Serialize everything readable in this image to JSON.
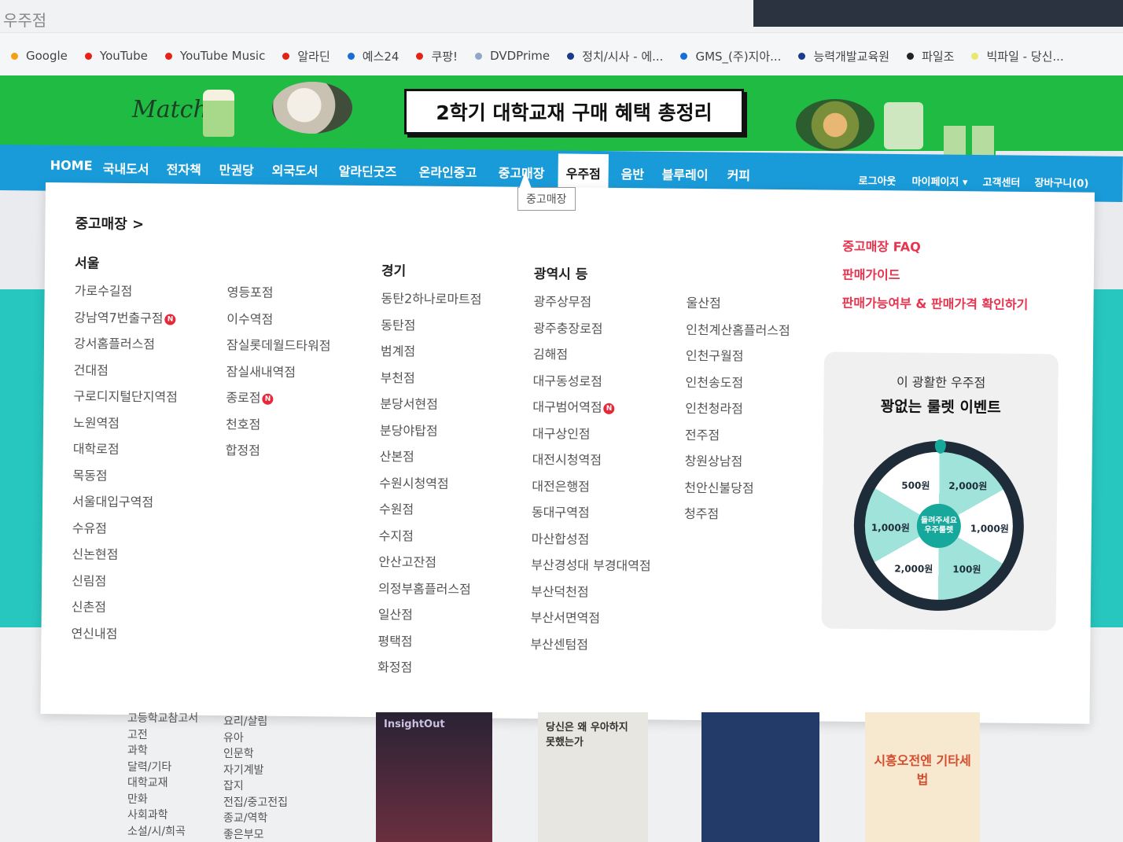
{
  "browser": {
    "tab_title": "우주점",
    "bookmarks": [
      {
        "label": "Google",
        "color": "#f4a017"
      },
      {
        "label": "YouTube",
        "color": "#e62117"
      },
      {
        "label": "YouTube Music",
        "color": "#e62117"
      },
      {
        "label": "알라딘",
        "color": "#e62117"
      },
      {
        "label": "예스24",
        "color": "#1a6cd6"
      },
      {
        "label": "쿠팡!",
        "color": "#e62117"
      },
      {
        "label": "DVDPrime",
        "color": "#8fa8c8"
      },
      {
        "label": "정치/시사 - 에...",
        "color": "#1a3a8a"
      },
      {
        "label": "GMS_(주)지아...",
        "color": "#1a6cd6"
      },
      {
        "label": "능력개발교육원",
        "color": "#1a3a8a"
      },
      {
        "label": "파일조",
        "color": "#222222"
      },
      {
        "label": "빅파일 - 당신...",
        "color": "#e8e86a"
      }
    ]
  },
  "banner": {
    "logo_text": "Matcha",
    "headline": "2학기 대학교재 구매 혜택 총정리"
  },
  "nav": {
    "items": [
      {
        "label": "HOME"
      },
      {
        "label": "국내도서"
      },
      {
        "label": "전자책"
      },
      {
        "label": "만권당"
      },
      {
        "label": "외국도서"
      },
      {
        "label": "알라딘굿즈"
      },
      {
        "label": "온라인중고"
      },
      {
        "label": "중고매장"
      },
      {
        "label": "우주점"
      },
      {
        "label": "음반"
      },
      {
        "label": "블루레이"
      },
      {
        "label": "커피"
      }
    ],
    "active": "우주점",
    "right": [
      {
        "label": "로그아웃"
      },
      {
        "label": "마이페이지 ▾"
      },
      {
        "label": "고객센터"
      },
      {
        "label": "장바구니(0)"
      }
    ],
    "tooltip": "중고매장"
  },
  "dropdown": {
    "title": "중고매장 >",
    "seoul": {
      "heading": "서울",
      "col1": [
        "가로수길점",
        "강남역7번출구점",
        "강서홈플러스점",
        "건대점",
        "구로디지털단지역점",
        "노원역점",
        "대학로점",
        "목동점",
        "서울대입구역점",
        "수유점",
        "신논현점",
        "신림점",
        "신촌점",
        "연신내점"
      ],
      "col2": [
        "영등포점",
        "이수역점",
        "잠실롯데월드타워점",
        "잠실새내역점",
        "종로점",
        "천호점",
        "합정점"
      ]
    },
    "gyeonggi": {
      "heading": "경기",
      "items": [
        "동탄2하나로마트점",
        "동탄점",
        "범계점",
        "부천점",
        "분당서현점",
        "분당야탑점",
        "산본점",
        "수원시청역점",
        "수원점",
        "수지점",
        "안산고잔점",
        "의정부홈플러스점",
        "일산점",
        "평택점",
        "화정점"
      ]
    },
    "metro": {
      "heading": "광역시 등",
      "col1": [
        "광주상무점",
        "광주충장로점",
        "김해점",
        "대구동성로점",
        "대구범어역점",
        "대구상인점",
        "대전시청역점",
        "대전은행점",
        "동대구역점",
        "마산합성점",
        "부산경성대 부경대역점",
        "부산덕천점",
        "부산서면역점",
        "부산센텀점"
      ],
      "col2": [
        "울산점",
        "인천계산홈플러스점",
        "인천구월점",
        "인천송도점",
        "인천청라점",
        "전주점",
        "창원상남점",
        "천안신불당점",
        "청주점"
      ]
    },
    "new_badge_text": "N",
    "links": [
      {
        "label": "중고매장 FAQ"
      },
      {
        "label": "판매가이드"
      },
      {
        "label": "판매가능여부 & 판매가격 확인하기"
      }
    ],
    "event": {
      "subtitle": "이 광활한 우주점",
      "title": "꽝없는 룰렛 이벤트",
      "hub_label": "돌려주세요 우주룰렛",
      "segments": [
        "500원",
        "2,000원",
        "1,000원",
        "1,000원",
        "2,000원",
        "100원"
      ]
    }
  },
  "below": {
    "categories_col1": [
      "고등학교참고서",
      "고전",
      "과학",
      "달력/기타",
      "대학교재",
      "만화",
      "사회과학",
      "소설/시/희곡"
    ],
    "categories_col2": [
      "요리/살림",
      "유아",
      "인문학",
      "자기계발",
      "잡지",
      "전집/중고전집",
      "종교/역학",
      "좋은부모"
    ],
    "books": [
      {
        "title": "InsightOut"
      },
      {
        "title": "당신은 왜 우아하지 못했는가"
      },
      {
        "title": ""
      },
      {
        "title": "시흥오전엔 기타세법"
      }
    ]
  }
}
